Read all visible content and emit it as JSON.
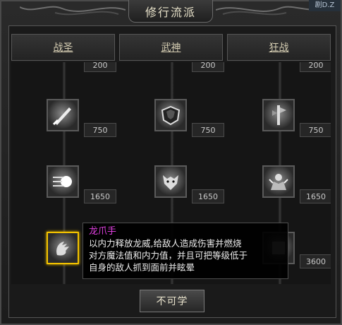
{
  "window": {
    "title": "修行流派",
    "corner_badge": "剧D.Z"
  },
  "tabs": [
    "战圣",
    "武神",
    "狂战"
  ],
  "columns": [
    {
      "name": "战圣",
      "skills": [
        {
          "icon": "blade-strike-icon",
          "cost": "750"
        },
        {
          "icon": "energy-wave-icon",
          "cost": "1650"
        },
        {
          "icon": "dragon-claw-icon",
          "cost": "",
          "selected": true
        }
      ],
      "top_cost": "200"
    },
    {
      "name": "武神",
      "skills": [
        {
          "icon": "armor-plate-icon",
          "cost": "750"
        },
        {
          "icon": "wolf-head-icon",
          "cost": "1650"
        }
      ],
      "top_cost": "200"
    },
    {
      "name": "狂战",
      "skills": [
        {
          "icon": "war-banner-icon",
          "cost": "750"
        },
        {
          "icon": "berserker-roar-icon",
          "cost": "1650"
        },
        {
          "icon": "skill-icon",
          "cost": "3600"
        }
      ],
      "top_cost": "200"
    }
  ],
  "tooltip": {
    "title": "龙爪手",
    "lines": [
      "以内力释放龙威,给敌人造成伤害并燃烧",
      "对方魔法值和内力值，并且可把等级低于",
      "自身的敌人抓到面前并眩晕"
    ]
  },
  "action_button": "不可学"
}
